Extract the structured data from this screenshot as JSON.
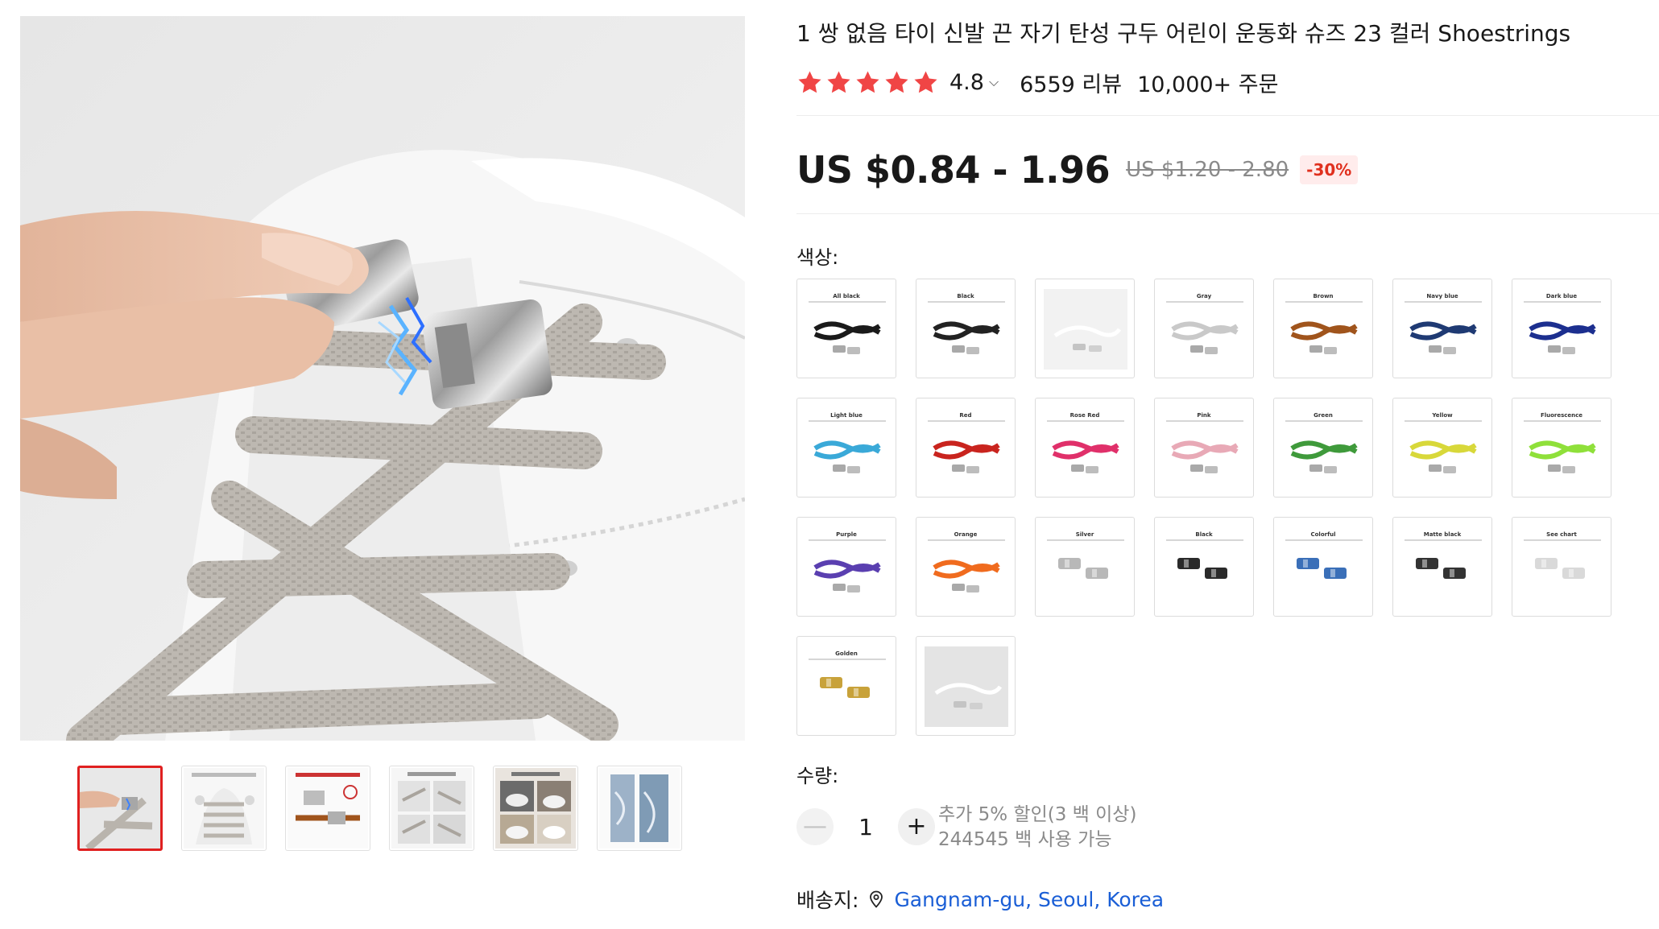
{
  "product": {
    "title": "1 쌍 없음 타이 신발 끈 자기 탄성 구두 어린이 운동화 슈즈 23 컬러 Shoestrings",
    "rating": "4.8",
    "reviews": "6559 리뷰",
    "orders": "10,000+ 주문",
    "star_count": 5,
    "star_color": "#f04545"
  },
  "price": {
    "current": "US $0.84 - 1.96",
    "original": "US $1.20 - 2.80",
    "discount": "-30%"
  },
  "color_section": {
    "label": "색상:",
    "swatches": [
      {
        "label": "All black",
        "color": "#1a1a1a",
        "kind": "lace"
      },
      {
        "label": "Black",
        "color": "#222222",
        "kind": "lace"
      },
      {
        "label": "White",
        "color": "#f2f2f2",
        "kind": "photo"
      },
      {
        "label": "Gray",
        "color": "#c9c9c9",
        "kind": "lace"
      },
      {
        "label": "Brown",
        "color": "#a0541c",
        "kind": "lace"
      },
      {
        "label": "Navy blue",
        "color": "#1f3a73",
        "kind": "lace"
      },
      {
        "label": "Dark blue",
        "color": "#1c2f8f",
        "kind": "lace"
      },
      {
        "label": "Light blue",
        "color": "#3aa9d8",
        "kind": "lace"
      },
      {
        "label": "Red",
        "color": "#c9241e",
        "kind": "lace"
      },
      {
        "label": "Rose Red",
        "color": "#e0306a",
        "kind": "lace"
      },
      {
        "label": "Pink",
        "color": "#e8a9b6",
        "kind": "lace"
      },
      {
        "label": "Green",
        "color": "#3f9a3b",
        "kind": "lace"
      },
      {
        "label": "Yellow",
        "color": "#d8d83a",
        "kind": "lace"
      },
      {
        "label": "Fluorescence",
        "color": "#8fe03a",
        "kind": "lace"
      },
      {
        "label": "Purple",
        "color": "#5a3fb0",
        "kind": "lace"
      },
      {
        "label": "Orange",
        "color": "#f06b1e",
        "kind": "lace"
      },
      {
        "label": "Silver",
        "color": "#b8b8b8",
        "kind": "clip"
      },
      {
        "label": "Black",
        "color": "#2a2a2a",
        "kind": "clip"
      },
      {
        "label": "Colorful",
        "color": "#3a6fb8",
        "kind": "clip"
      },
      {
        "label": "Matte black",
        "color": "#333333",
        "kind": "clip"
      },
      {
        "label": "See chart",
        "color": "#d9d9d9",
        "kind": "clip"
      },
      {
        "label": "Golden",
        "color": "#c8a23a",
        "kind": "clip"
      },
      {
        "label": "White",
        "color": "#e4e4e4",
        "kind": "photo"
      }
    ]
  },
  "quantity": {
    "label": "수량:",
    "value": "1",
    "minus": "—",
    "plus": "+",
    "bulk_discount": "추가 5% 할인(3 백 이상)",
    "available": "244545 백 사용 가능"
  },
  "shipping": {
    "label": "배송지:",
    "location": "Gangnam-gu, Seoul, Korea",
    "icon": "location-pin-icon"
  },
  "gallery": {
    "thumbnails": [
      "thumb-1",
      "thumb-2",
      "thumb-3",
      "thumb-4",
      "thumb-5",
      "thumb-6"
    ],
    "active_index": 0
  },
  "colors": {
    "star": "#f04545",
    "discount_text": "#e0301e",
    "discount_bg": "#ffecec",
    "link": "#1a5ed6",
    "active_thumb_border": "#e02020"
  }
}
